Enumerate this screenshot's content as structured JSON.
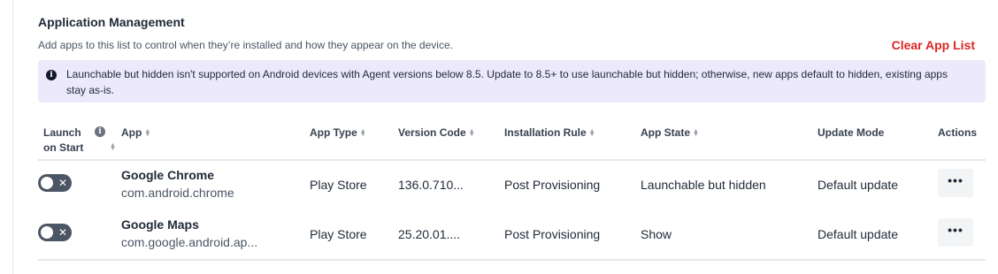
{
  "section": {
    "title": "Application Management",
    "description": "Add apps to this list to control when they’re installed and how they appear on the device.",
    "clear_label": "Clear App List"
  },
  "notice": {
    "icon": "info-icon",
    "text": "Launchable but hidden isn't supported on Android devices with Agent versions below 8.5. Update to 8.5+ to use launchable but hidden; otherwise, new apps default to hidden, existing apps stay as-is."
  },
  "table": {
    "headers": {
      "launch_line1": "Launch",
      "launch_line2": "on Start",
      "app": "App",
      "app_type": "App Type",
      "version_code": "Version Code",
      "installation_rule": "Installation Rule",
      "app_state": "App State",
      "update_mode": "Update Mode",
      "actions": "Actions"
    },
    "rows": [
      {
        "launch_on_start": false,
        "name": "Google Chrome",
        "package": "com.android.chrome",
        "app_type": "Play Store",
        "version_code": "136.0.710...",
        "installation_rule": "Post Provisioning",
        "app_state": "Launchable but hidden",
        "update_mode": "Default update",
        "actions_label": "•••"
      },
      {
        "launch_on_start": false,
        "name": "Google Maps",
        "package": "com.google.android.ap...",
        "app_type": "Play Store",
        "version_code": "25.20.01....",
        "installation_rule": "Post Provisioning",
        "app_state": "Show",
        "update_mode": "Default update",
        "actions_label": "•••"
      }
    ]
  },
  "colors": {
    "accent_danger": "#dc2626",
    "notice_bg": "#ece9fb",
    "toggle_off": "#4b5563"
  }
}
